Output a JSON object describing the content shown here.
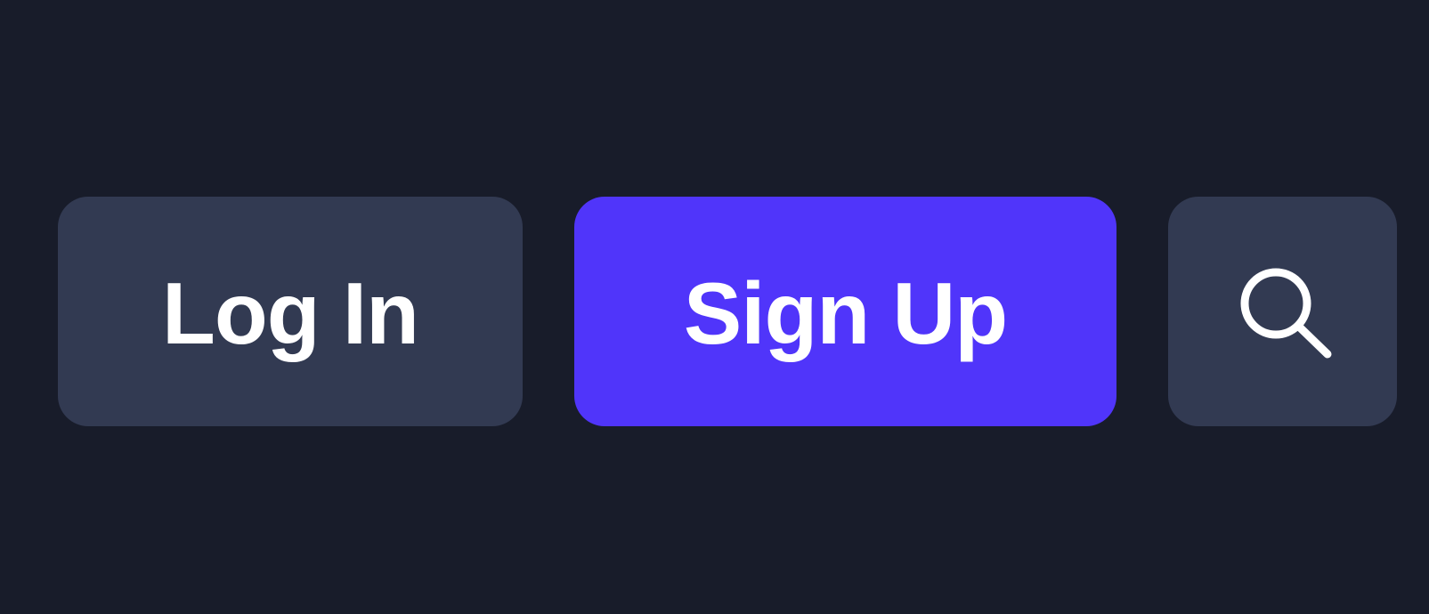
{
  "theme": {
    "background": "#181c2a",
    "secondary_button": "#323a52",
    "primary_button": "#5035fa",
    "text": "#ffffff"
  },
  "auth_bar": {
    "login_label": "Log In",
    "signup_label": "Sign Up",
    "search_icon": "search-icon"
  }
}
